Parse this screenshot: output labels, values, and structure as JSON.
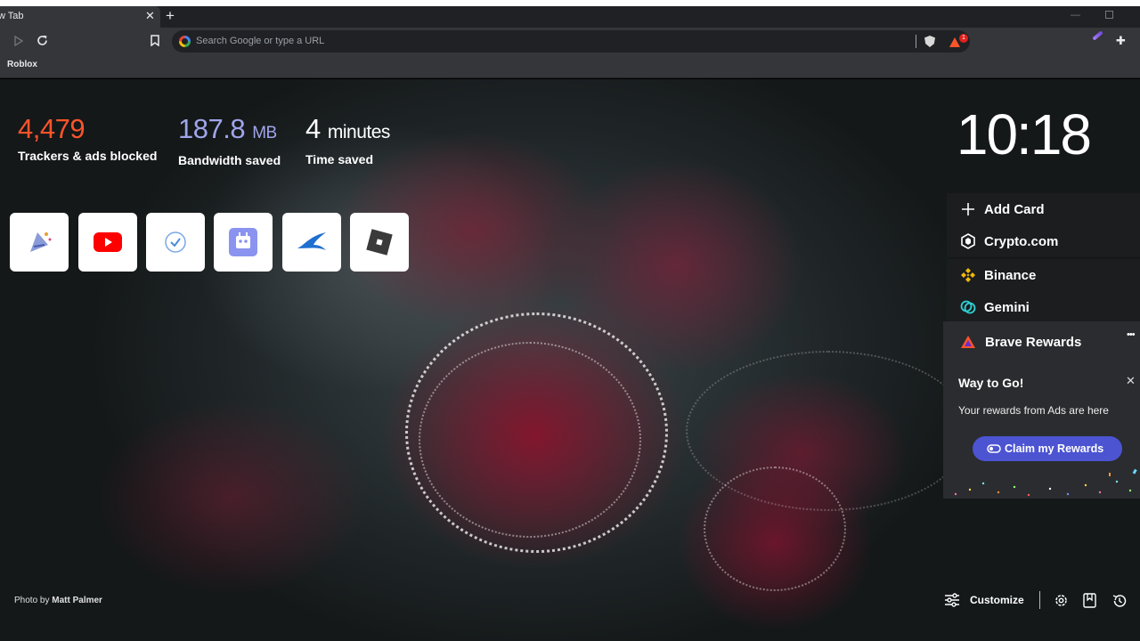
{
  "browser": {
    "tab_title": "w Tab",
    "tab_close": "✕",
    "new_tab": "+",
    "omnibox_placeholder": "Search Google or type a URL",
    "rewards_badge_count": "1",
    "bookmarks": [
      "Roblox"
    ],
    "window_controls": {
      "minimize": "—"
    }
  },
  "stats": {
    "trackers": {
      "value": "4,479",
      "label": "Trackers & ads blocked",
      "color": "#fb542b"
    },
    "bandwidth": {
      "value": "187.8",
      "unit": "MB",
      "label": "Bandwidth saved",
      "color": "#a0a5eb"
    },
    "time": {
      "value": "4",
      "unit": "minutes",
      "label": "Time saved",
      "color": "#ffffff"
    }
  },
  "clock": {
    "time": "10:18"
  },
  "top_sites": [
    {
      "name": "party-popper-site",
      "icon": "party-popper-icon"
    },
    {
      "name": "youtube",
      "icon": "youtube-icon"
    },
    {
      "name": "checkmark-site",
      "icon": "checkmark-circle-icon"
    },
    {
      "name": "robot-site",
      "icon": "robot-icon"
    },
    {
      "name": "swift-site",
      "icon": "swift-bird-icon"
    },
    {
      "name": "roblox",
      "icon": "roblox-icon"
    }
  ],
  "cards": {
    "add_card": "Add Card",
    "crypto": "Crypto.com",
    "binance": "Binance",
    "gemini": "Gemini",
    "brave_rewards": "Brave Rewards",
    "more": "•••"
  },
  "rewards_panel": {
    "title": "Way to Go!",
    "body": "Your rewards from Ads are here",
    "claim_button": "Claim my Rewards",
    "close": "✕",
    "button_color": "#4c54d2"
  },
  "photo_credit": {
    "prefix": "Photo by ",
    "author": "Matt Palmer"
  },
  "footer": {
    "customize": "Customize"
  }
}
